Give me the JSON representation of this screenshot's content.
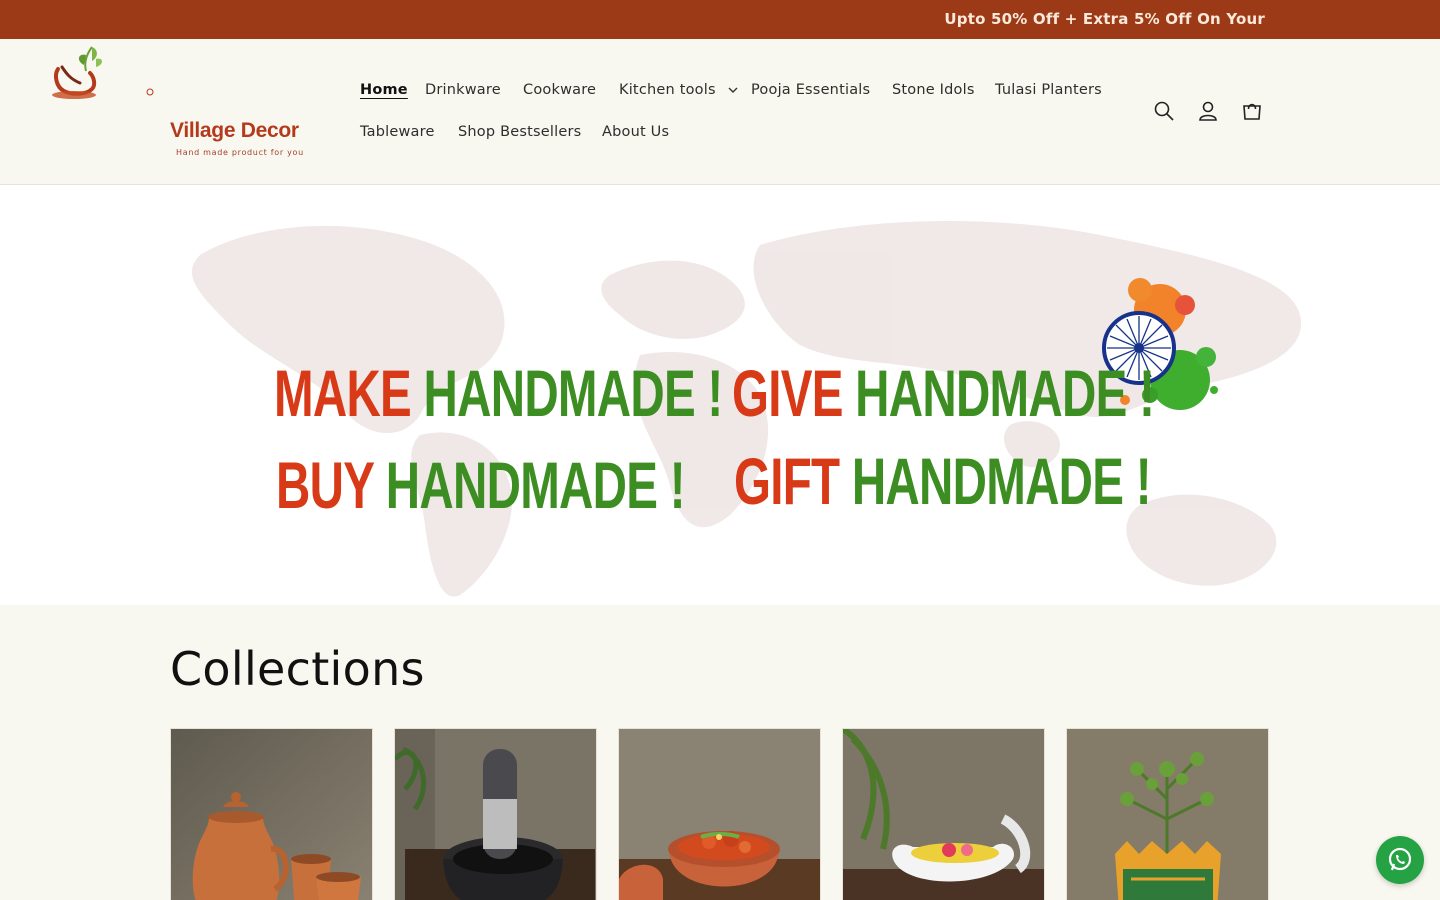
{
  "announcement": {
    "text": "Upto 50% Off + Extra 5% Off On Your"
  },
  "brand": {
    "name": "Village Decor",
    "tagline": "Hand made product for you",
    "logo_icon": "clay-pot-with-leaves-logo"
  },
  "nav": {
    "items": [
      {
        "label": "Home",
        "active": true
      },
      {
        "label": "Drinkware"
      },
      {
        "label": "Cookware"
      },
      {
        "label": "Kitchen tools",
        "has_dropdown": true
      },
      {
        "label": "Pooja Essentials"
      },
      {
        "label": "Stone Idols"
      },
      {
        "label": "Tulasi Planters"
      },
      {
        "label": "Tableware"
      },
      {
        "label": "Shop Bestsellers"
      },
      {
        "label": "About Us"
      }
    ]
  },
  "header_icons": [
    "search-icon",
    "account-icon",
    "cart-icon"
  ],
  "hero": {
    "line1": [
      "MAKE",
      "HANDMADE !",
      "GIVE",
      "HANDMADE !"
    ],
    "line2": [
      "BUY",
      "HANDMADE !",
      "GIFT",
      "HANDMADE !"
    ],
    "accent_red": "#d83a17",
    "accent_green": "#3d8e22",
    "decor_icon": "ashoka-chakra-tricolor-splash-icon"
  },
  "collections": {
    "title": "Collections",
    "cards": [
      {
        "image": "clay-jug-and-cups-image"
      },
      {
        "image": "stone-mortar-pestle-image"
      },
      {
        "image": "clay-cooking-pot-with-curry-image"
      },
      {
        "image": "white-shell-flower-bowl-image"
      },
      {
        "image": "tulasi-plant-in-planter-image"
      }
    ]
  },
  "colors": {
    "announcement_bg": "#9c3a18",
    "page_bg": "#f8f8f0",
    "whatsapp": "#25a244"
  },
  "floating": {
    "icon": "whatsapp-icon"
  }
}
